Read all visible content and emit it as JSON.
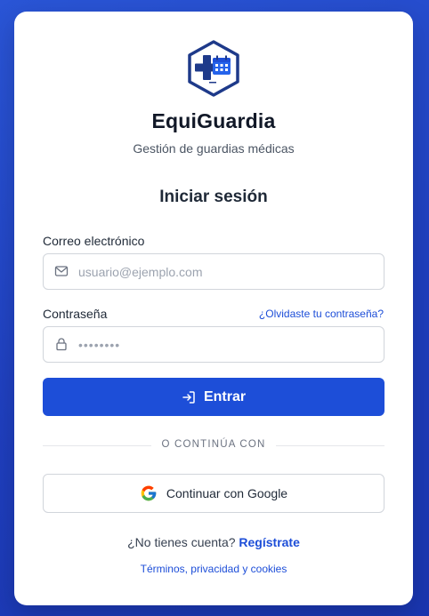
{
  "brand": {
    "name": "EquiGuardia",
    "tagline": "Gestión de guardias médicas",
    "logo_icon": "hospital-calendar-icon",
    "color_primary": "#1d4ed8",
    "color_navy": "#1e3a8a"
  },
  "form": {
    "title": "Iniciar sesión",
    "email": {
      "label": "Correo electrónico",
      "placeholder": "usuario@ejemplo.com",
      "icon": "mail-icon"
    },
    "password": {
      "label": "Contraseña",
      "placeholder": "••••••••",
      "icon": "lock-icon",
      "forgot_label": "¿Olvidaste tu contraseña?"
    },
    "submit_label": "Entrar",
    "submit_icon": "login-icon"
  },
  "divider_text": "O CONTINÚA CON",
  "google": {
    "label": "Continuar con Google",
    "icon": "google-icon"
  },
  "signup": {
    "prompt": "¿No tienes cuenta?",
    "link_label": "Regístrate"
  },
  "footer": {
    "terms_label": "Términos, privacidad y cookies"
  }
}
